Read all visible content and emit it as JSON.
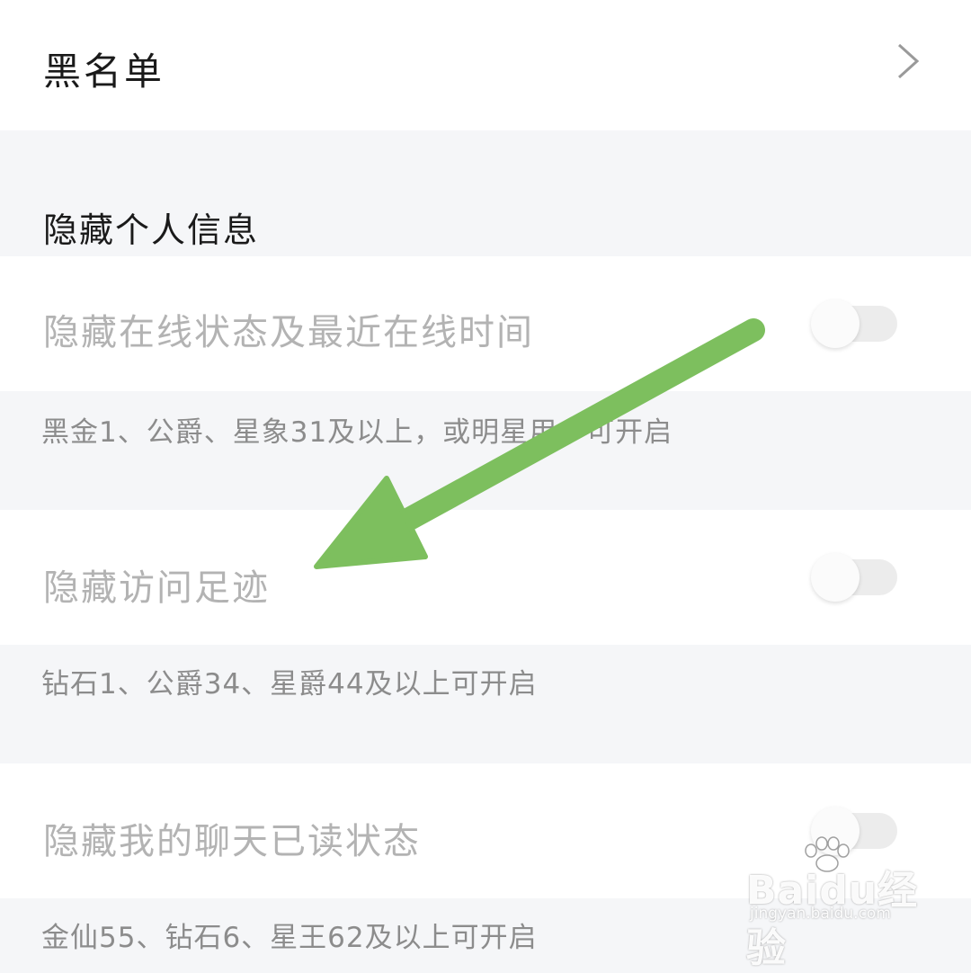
{
  "blacklist": {
    "label": "黑名单"
  },
  "section": {
    "title": "隐藏个人信息"
  },
  "settings": [
    {
      "label": "隐藏在线状态及最近在线时间",
      "hint": "黑金1、公爵、星象31及以上，或明星用户可开启",
      "enabled": false
    },
    {
      "label": "隐藏访问足迹",
      "hint": "钻石1、公爵34、星爵44及以上可开启",
      "enabled": false
    },
    {
      "label": "隐藏我的聊天已读状态",
      "hint": "金仙55、钻石6、星王62及以上可开启",
      "enabled": false
    }
  ],
  "watermark": {
    "brand": "Baidu经验",
    "url": "jingyan.baidu.com"
  },
  "colors": {
    "arrow": "#7dbf5e",
    "label_disabled": "#b3b3b3",
    "hint": "#8c8c8c",
    "background": "#f5f6f8"
  }
}
